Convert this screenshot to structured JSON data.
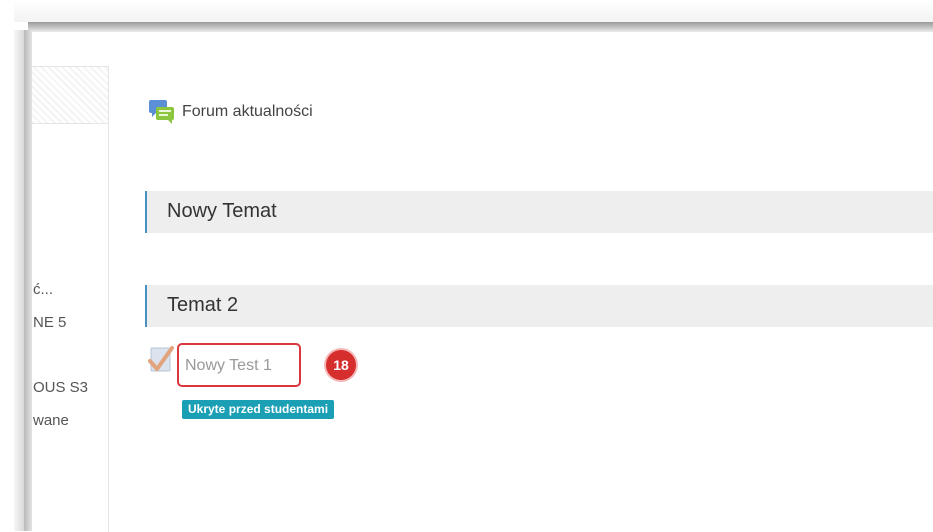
{
  "sidebar": {
    "items": [
      {
        "label": "ć..."
      },
      {
        "label": "NE 5"
      },
      {
        "label": "OUS S3"
      },
      {
        "label": "wane"
      }
    ]
  },
  "main": {
    "forum": {
      "label": "Forum aktualności",
      "icon": "forum-chat-icon"
    },
    "sections": [
      {
        "title": "Nowy Temat"
      },
      {
        "title": "Temat 2"
      }
    ],
    "activity": {
      "name": "Nowy Test 1",
      "icon": "quiz-checkmark-icon",
      "step_number": "18",
      "visibility_badge": "Ukryte przed studentami"
    }
  },
  "colors": {
    "section_accent": "#4a90c2",
    "highlight_red": "#d9363e",
    "badge_teal": "#1a9fb5"
  }
}
